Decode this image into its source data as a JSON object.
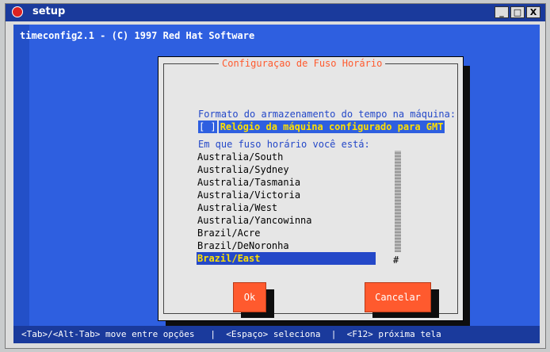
{
  "window": {
    "title": "setup",
    "buttons": {
      "minimize": "_",
      "maximize": "□",
      "close": "X"
    }
  },
  "terminal": {
    "header": "timeconfig2.1 - (C) 1997 Red Hat Software"
  },
  "dialog": {
    "title": "Configuraçao de Fuso Horário",
    "storage_label": "Formato do armazenamento do tempo na máquina:",
    "checkbox_state": "[ ]",
    "checkbox_label": "Relógio da máquina configurado para GMT",
    "timezone_label": "Em que fuso horário você está:",
    "timezones": [
      "Australia/South",
      "Australia/Sydney",
      "Australia/Tasmania",
      "Australia/Victoria",
      "Australia/West",
      "Australia/Yancowinna",
      "Brazil/Acre",
      "Brazil/DeNoronha",
      "Brazil/East"
    ],
    "selected_timezone": "Brazil/East",
    "scroll_thumb": "#",
    "ok_label": "Ok",
    "cancel_label": "Cancelar"
  },
  "status_bar": {
    "text": "<Tab>/<Alt-Tab> move entre opções   |  <Espaço> seleciona  |  <F12> próxima tela"
  },
  "colors": {
    "terminal_bg": "#2e5fe0",
    "title_bar": "#1a3a9c",
    "dialog_bg": "#e6e6e6",
    "accent": "#ff5a2e",
    "selection_bg": "#2448c8",
    "selection_fg": "#ffe000"
  }
}
